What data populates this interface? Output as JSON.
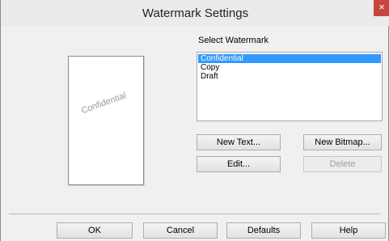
{
  "window": {
    "title": "Watermark Settings",
    "close_glyph": "×"
  },
  "preview": {
    "watermark_text": "Confidential"
  },
  "watermark_list": {
    "label": "Select Watermark",
    "items": [
      "Confidential",
      "Copy",
      "Draft"
    ],
    "selected": "Confidential"
  },
  "buttons": {
    "new_text": "New Text...",
    "new_bitmap": "New Bitmap...",
    "edit": "Edit...",
    "delete": "Delete",
    "ok": "OK",
    "cancel": "Cancel",
    "defaults": "Defaults",
    "help": "Help"
  },
  "colors": {
    "selection": "#3399ff",
    "close_button": "#c7453c"
  }
}
